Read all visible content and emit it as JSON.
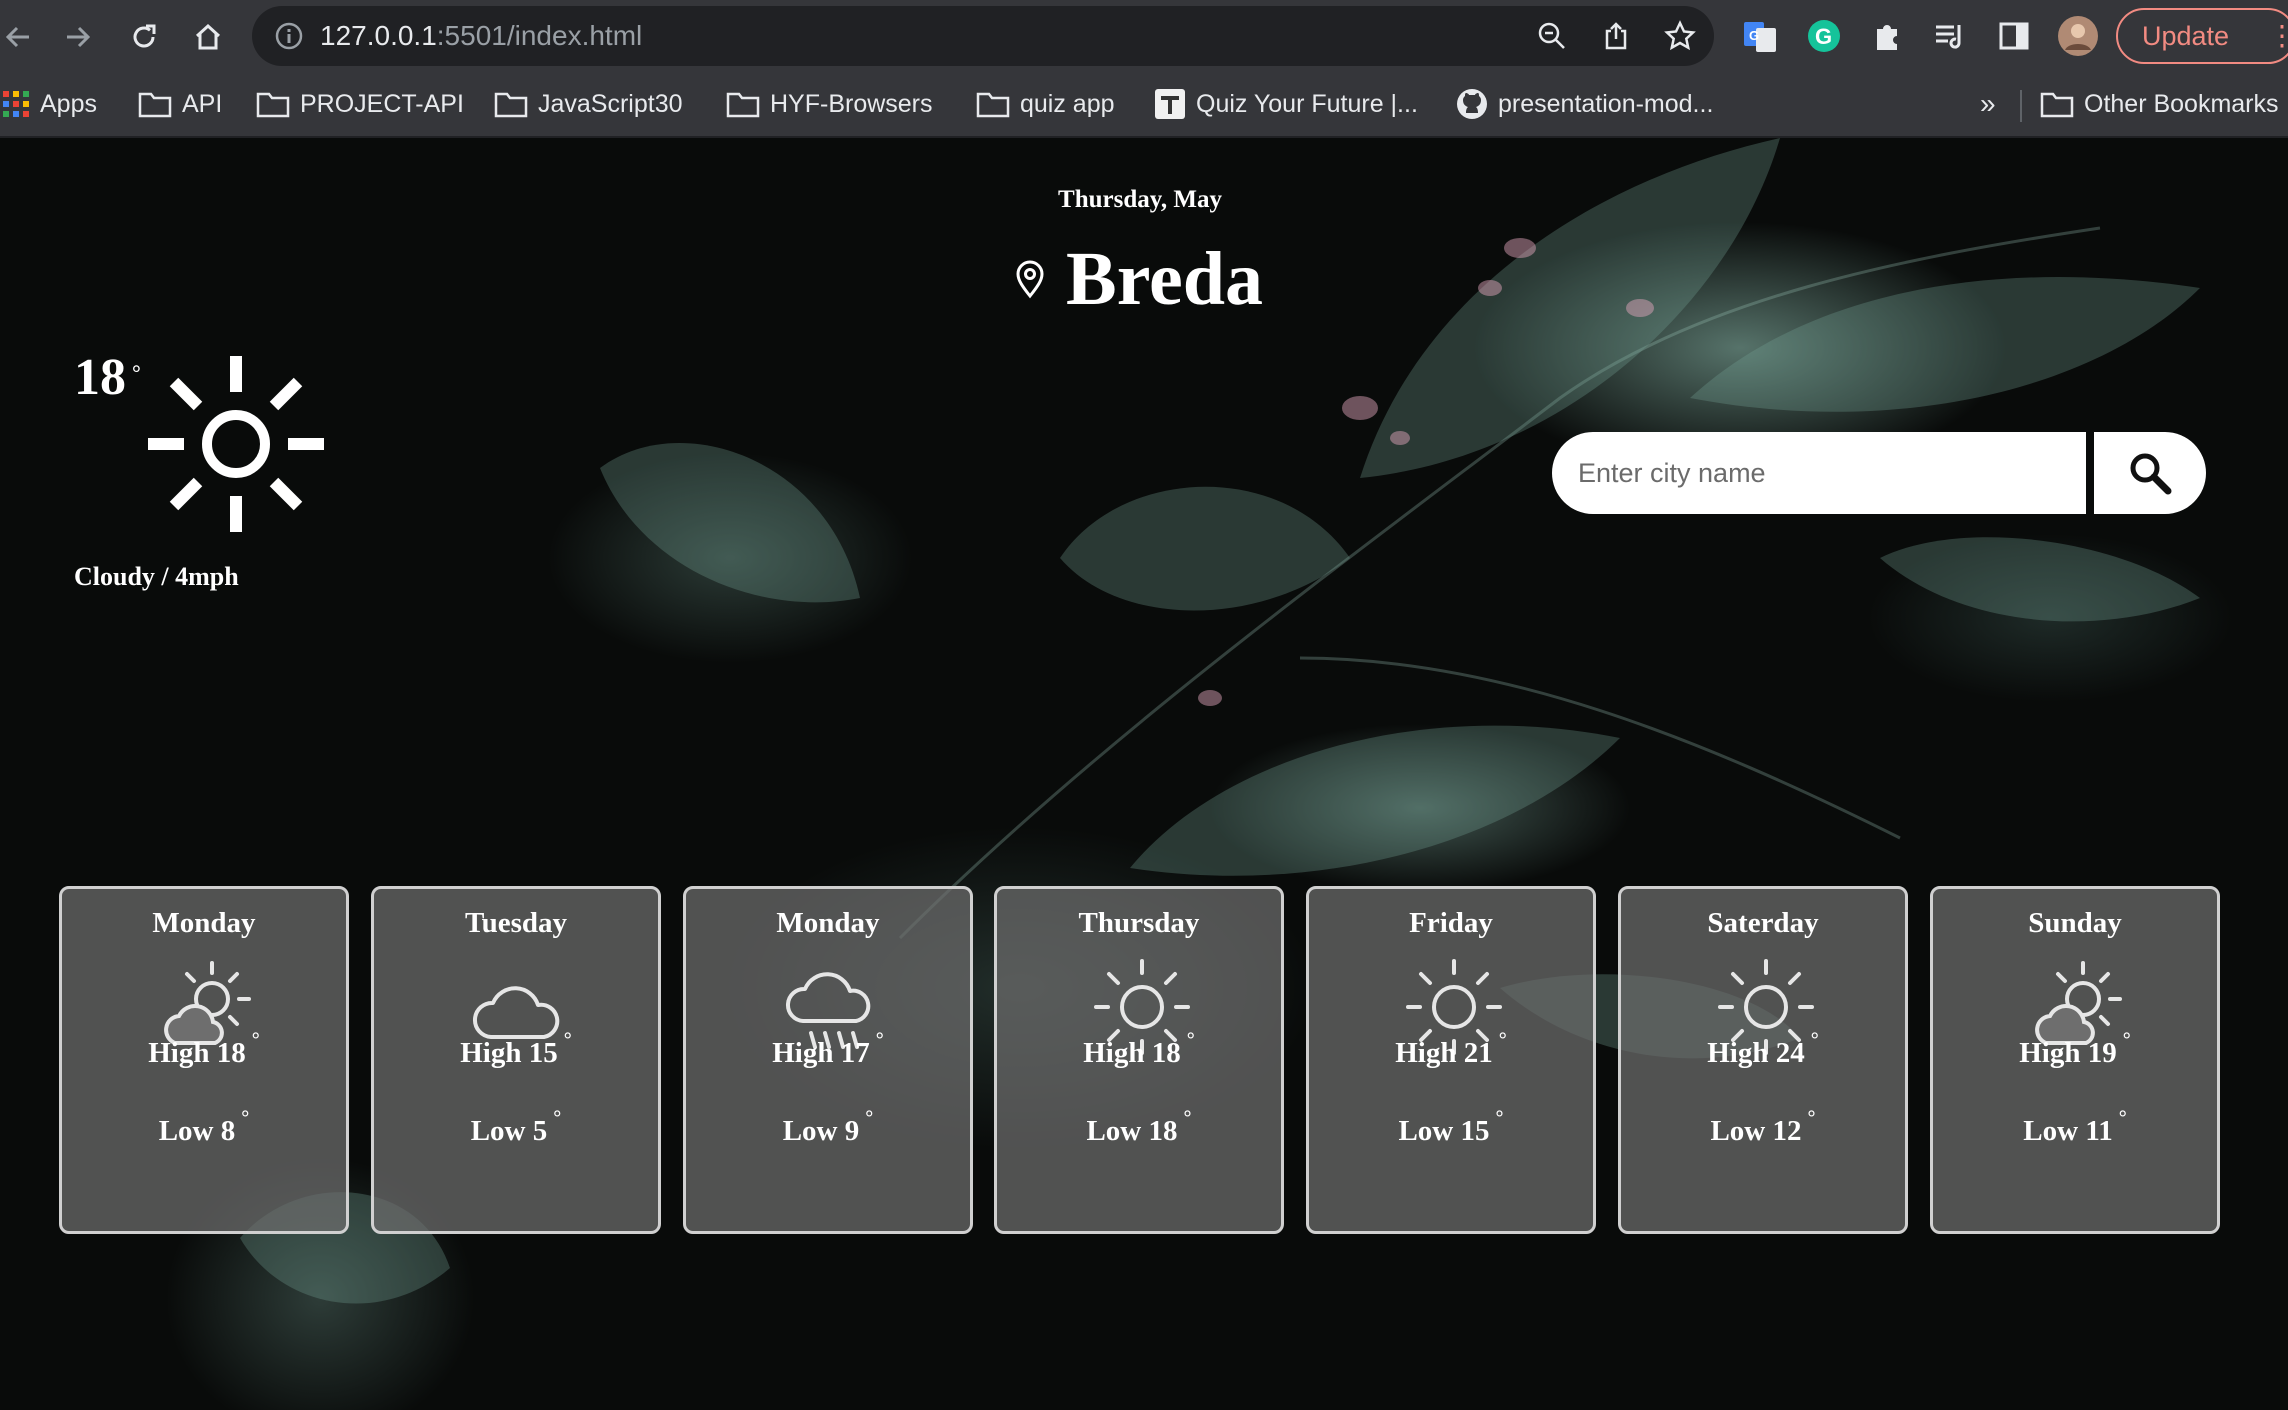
{
  "browser": {
    "url_host": "127.0.0.1",
    "url_rest": ":5501/index.html",
    "update_label": "Update",
    "bookmarks": [
      {
        "label": "Apps",
        "icon": "apps-grid-icon"
      },
      {
        "label": "API",
        "icon": "folder-icon"
      },
      {
        "label": "PROJECT-API",
        "icon": "folder-icon"
      },
      {
        "label": "JavaScript30",
        "icon": "folder-icon"
      },
      {
        "label": "HYF-Browsers",
        "icon": "folder-icon"
      },
      {
        "label": "quiz app",
        "icon": "folder-icon"
      },
      {
        "label": "Quiz Your Future |...",
        "icon": "site-favicon-icon"
      },
      {
        "label": "presentation-mod...",
        "icon": "github-icon"
      },
      {
        "label": "Other Bookmarks",
        "icon": "folder-icon"
      }
    ],
    "overflow_label": "»"
  },
  "header": {
    "date": "Thursday, May",
    "city": "Breda"
  },
  "current": {
    "temp": "18",
    "degree_symbol": "°",
    "icon": "sun-icon",
    "description": "Cloudy / 4mph"
  },
  "search": {
    "placeholder": "Enter city name"
  },
  "forecast": [
    {
      "day": "Monday",
      "icon": "partly-cloudy-icon",
      "high": "High 18",
      "low": "Low 8",
      "deg": "°"
    },
    {
      "day": "Tuesday",
      "icon": "cloud-icon",
      "high": "High 15",
      "low": "Low 5",
      "deg": "°"
    },
    {
      "day": "Monday",
      "icon": "rain-cloud-icon",
      "high": "High 17",
      "low": "Low 9",
      "deg": "°"
    },
    {
      "day": "Thursday",
      "icon": "sun-icon",
      "high": "High 18",
      "low": "Low 18",
      "deg": "°"
    },
    {
      "day": "Friday",
      "icon": "sun-icon",
      "high": "High 21",
      "low": "Low 15",
      "deg": "°"
    },
    {
      "day": "Saterday",
      "icon": "sun-icon",
      "high": "High 24",
      "low": "Low 12",
      "deg": "°"
    },
    {
      "day": "Sunday",
      "icon": "partly-cloudy-icon",
      "high": "High 19",
      "low": "Low 11",
      "deg": "°"
    }
  ]
}
